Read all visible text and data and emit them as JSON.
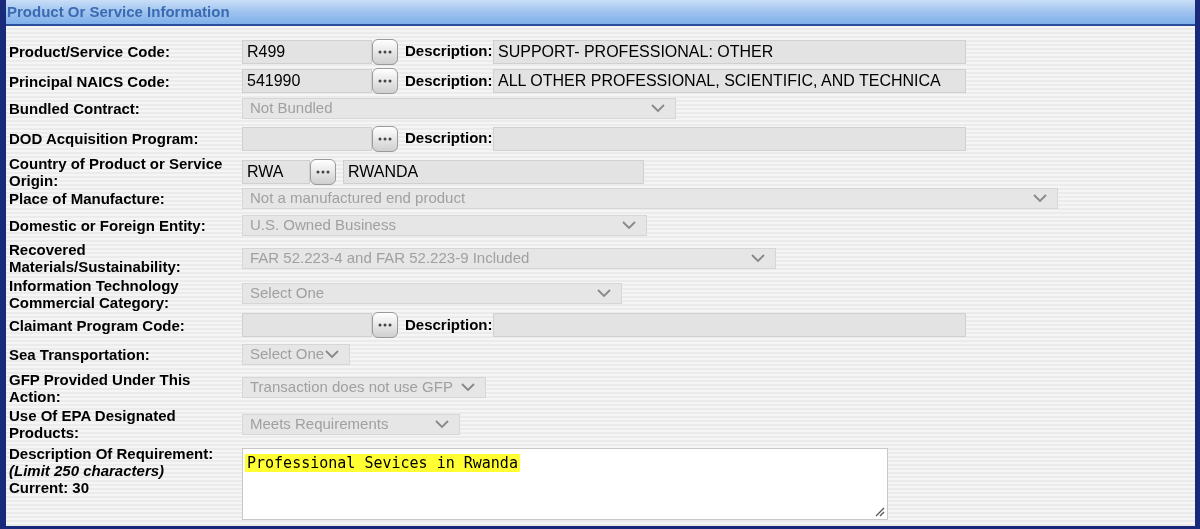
{
  "section": {
    "title": "Product Or Service Information"
  },
  "rows": [
    {
      "kind": "lookup",
      "label": "Product/Service Code:",
      "code": "R499",
      "description_label": "Description:",
      "description": "SUPPORT- PROFESSIONAL: OTHER"
    },
    {
      "kind": "lookup",
      "label": "Principal NAICS Code:",
      "code": "541990",
      "description_label": "Description:",
      "description": "ALL OTHER PROFESSIONAL, SCIENTIFIC, AND TECHNICA"
    },
    {
      "kind": "select",
      "label": "Bundled Contract:",
      "value": "Not Bundled",
      "disabled": true
    },
    {
      "kind": "lookup",
      "label": "DOD Acquisition Program:",
      "description_label": "Description:"
    },
    {
      "kind": "country",
      "label": "Country of Product or Service Origin:",
      "code": "RWA",
      "name": "RWANDA"
    },
    {
      "kind": "select",
      "label": "Place of Manufacture:",
      "value": "Not a manufactured end product",
      "disabled": true
    },
    {
      "kind": "select",
      "label": "Domestic or Foreign Entity:",
      "value": "U.S. Owned Business",
      "disabled": true
    },
    {
      "kind": "select",
      "label": "Recovered Materials/Sustainability:",
      "value": "FAR 52.223-4 and FAR 52.223-9 Included",
      "disabled": true
    },
    {
      "kind": "select",
      "label": "Information Technology Commercial Category:",
      "value": "Select One",
      "disabled": true
    },
    {
      "kind": "lookup",
      "label": "Claimant Program Code:",
      "description_label": "Description:"
    },
    {
      "kind": "select",
      "label": "Sea Transportation:",
      "value": "Select One",
      "disabled": true
    },
    {
      "kind": "select",
      "label": "GFP Provided Under This Action:",
      "value": "Transaction does not use GFP",
      "disabled": true
    },
    {
      "kind": "select",
      "label": "Use Of EPA Designated Products:",
      "value": "Meets Requirements",
      "disabled": true
    },
    {
      "kind": "textarea",
      "label": "Description Of Requirement:",
      "note": "(Limit 250 characters)",
      "counter": "Current: 30",
      "value": "Professional Sevices in Rwanda",
      "highlighted": true
    }
  ]
}
